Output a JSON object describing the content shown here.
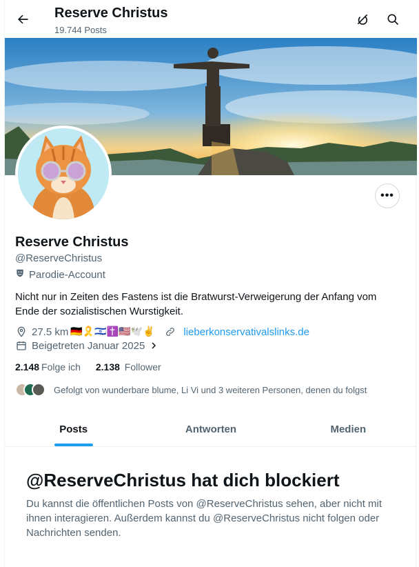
{
  "header": {
    "title": "Reserve Christus",
    "posts_count": "19.744 Posts"
  },
  "profile": {
    "name": "Reserve Christus",
    "handle": "@ReserveChristus",
    "label": "Parodie-Account",
    "bio": "Nicht nur in Zeiten des Fastens ist die Bratwurst-Verweigerung der Anfang vom Ende der sozialistischen Wurstigkeit.",
    "location": "27.5 km",
    "location_emojis": "🇩🇪🎗️🇮🇱✝️🇺🇸🕊️✌️",
    "website": "lieberkonservativalslinks.de",
    "joined": "Beigetreten Januar 2025",
    "following_count": "2.148",
    "following_label": "Folge ich",
    "followers_count": "2.138",
    "followers_label": "Follower",
    "followed_by": "Gefolgt von wunderbare blume, Li Vi und 3 weiteren Personen, denen du folgst"
  },
  "tabs": [
    {
      "label": "Posts",
      "active": true
    },
    {
      "label": "Antworten",
      "active": false
    },
    {
      "label": "Medien",
      "active": false
    }
  ],
  "blocked": {
    "title": "@ReserveChristus hat dich blockiert",
    "text": "Du kannst die öffentlichen Posts von @ReserveChristus sehen, aber nicht mit ihnen interagieren. Außerdem kannst du @ReserveChristus nicht folgen oder Nachrichten senden."
  },
  "colors": {
    "accent": "#1d9bf0",
    "text_primary": "#0f1419",
    "text_secondary": "#536471"
  },
  "icons": [
    "back-arrow-icon",
    "grok-icon",
    "search-icon",
    "more-icon",
    "parody-mask-icon",
    "location-pin-icon",
    "link-icon",
    "calendar-icon",
    "chevron-right-icon"
  ]
}
